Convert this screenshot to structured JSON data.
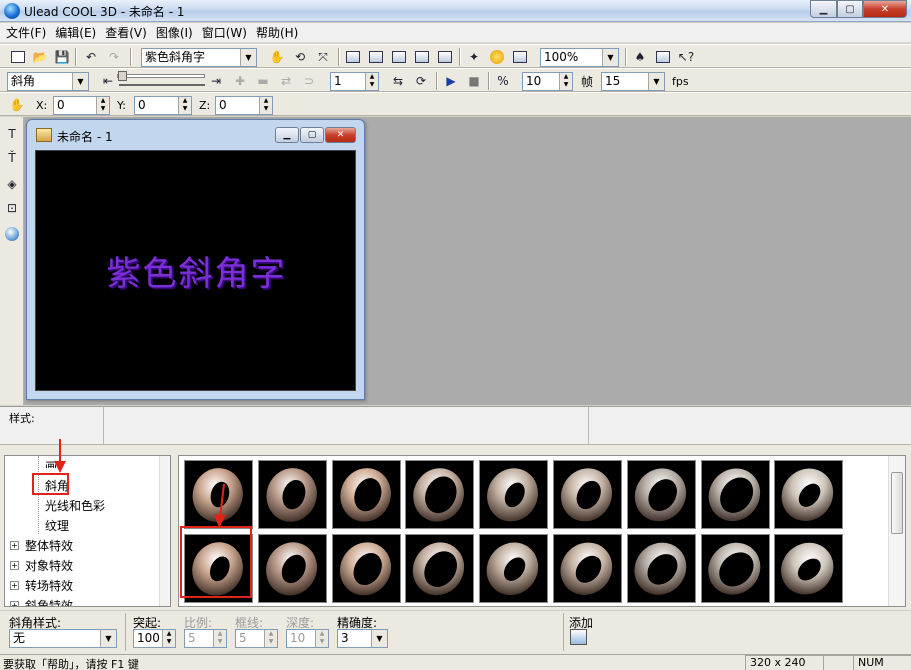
{
  "window": {
    "title": "Ulead COOL 3D - 未命名 - 1"
  },
  "menu": [
    "文件(F)",
    "编辑(E)",
    "查看(V)",
    "图像(I)",
    "窗口(W)",
    "帮助(H)"
  ],
  "toolbar1": {
    "text_combo": "紫色斜角字",
    "zoom_combo": "100%"
  },
  "toolbar2": {
    "effect_combo": "斜角",
    "frame_value": "1",
    "rate_value": "10",
    "frames_label": "帧",
    "fps_combo": "15",
    "fps_label": "fps"
  },
  "toolbar3": {
    "x_label": "X:",
    "x_value": "0",
    "y_label": "Y:",
    "y_value": "0",
    "z_label": "Z:",
    "z_value": "0"
  },
  "document": {
    "title": "未命名 - 1",
    "text": "紫色斜角字",
    "text_color": "#7b2fd6"
  },
  "style_strip": {
    "label": "样式:"
  },
  "tree": {
    "children": [
      "画",
      "斜角",
      "光线和色彩",
      "纹理"
    ],
    "groups": [
      "整体特效",
      "对象特效",
      "转场特效",
      "斜角特效"
    ],
    "selected": "斜角"
  },
  "gallery": {
    "rows": 2,
    "cols": 9,
    "selected_index": 9
  },
  "props": {
    "bevel_style_label": "斜角样式:",
    "bevel_style_value": "无",
    "extrude_label": "突起:",
    "extrude_value": "100",
    "ratio_label": "比例:",
    "ratio_value": "5",
    "border_label": "框线:",
    "border_value": "5",
    "depth_label": "深度:",
    "depth_value": "10",
    "precision_label": "精确度:",
    "precision_value": "3",
    "add_label": "添加"
  },
  "status": {
    "help_text": "要获取「帮助」，请按 F1 键",
    "size": "320 x 240",
    "num": "NUM"
  },
  "colors": {
    "highlight": "#e2231a",
    "titlebar": "#c9daf0",
    "mdi_bg": "#ababab"
  }
}
